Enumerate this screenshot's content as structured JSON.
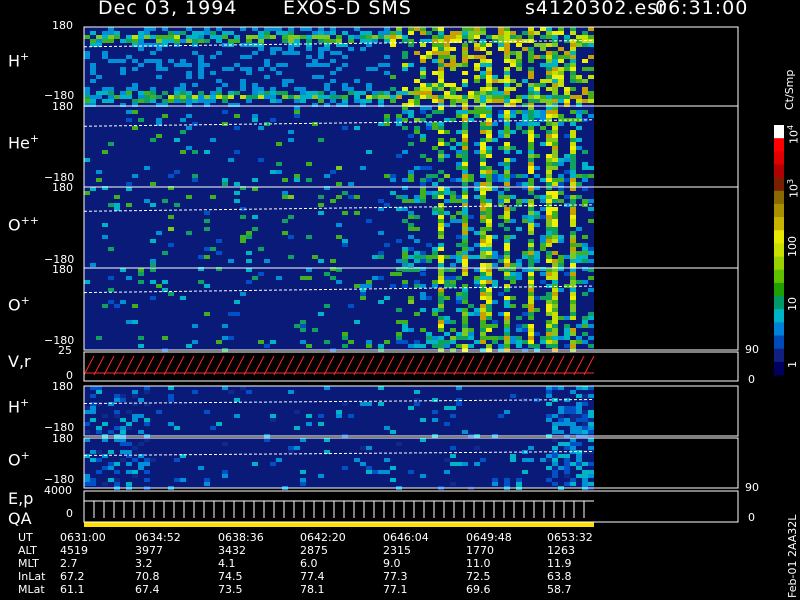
{
  "header": {
    "date": "Dec 03, 1994",
    "instrument": "EXOS-D SMS",
    "file": "s4120302.esr",
    "time": "06:31:00"
  },
  "panels": [
    {
      "label": "H",
      "sup": "+",
      "top": "180",
      "bottom": "−180"
    },
    {
      "label": "He",
      "sup": "+",
      "top": "180",
      "bottom": "−180"
    },
    {
      "label": "O",
      "sup": "++",
      "top": "180",
      "bottom": "−180"
    },
    {
      "label": "O",
      "sup": "+",
      "top": "180",
      "bottom": "−180"
    },
    {
      "label": "V,r",
      "sup": "",
      "top": "25",
      "bottom": "0",
      "right_top": "90",
      "right_bottom": "0"
    },
    {
      "label": "H",
      "sup": "+",
      "top": "180",
      "bottom": "−180"
    },
    {
      "label": "O",
      "sup": "+",
      "top": "180",
      "bottom": "−180"
    },
    {
      "label": "E,p",
      "sup": "",
      "top": "4000",
      "bottom": "0",
      "right_top": "90",
      "right_bottom": "0"
    }
  ],
  "qa_label": "QA",
  "colorbar": {
    "unit": "Ct/Smp",
    "ticks": [
      {
        "base": "10",
        "exp": "4"
      },
      {
        "base": "10",
        "exp": "3"
      },
      {
        "base": "100",
        "exp": ""
      },
      {
        "base": "10",
        "exp": ""
      },
      {
        "base": "1",
        "exp": ""
      }
    ],
    "colors": [
      "#ffffff",
      "#ff0000",
      "#e00000",
      "#b00000",
      "#7a1e00",
      "#8a6a00",
      "#a88f00",
      "#c8b400",
      "#e8e800",
      "#c8e000",
      "#98d000",
      "#5fc000",
      "#20a000",
      "#009a6a",
      "#00b4c8",
      "#0080d8",
      "#004ab8",
      "#102080",
      "#000060"
    ]
  },
  "table": {
    "headers": [
      "UT",
      "ALT",
      "MLT",
      "InLat",
      "MLat"
    ],
    "columns": [
      [
        "0631:00",
        "4519",
        "2.7",
        "67.2",
        "61.1"
      ],
      [
        "0634:52",
        "3977",
        "3.2",
        "70.8",
        "67.4"
      ],
      [
        "0638:36",
        "3432",
        "4.1",
        "74.5",
        "73.5"
      ],
      [
        "0642:20",
        "2875",
        "6.0",
        "77.4",
        "78.1"
      ],
      [
        "0646:04",
        "2315",
        "9.0",
        "77.3",
        "77.1"
      ],
      [
        "0649:48",
        "1770",
        "11.0",
        "72.5",
        "69.6"
      ],
      [
        "0653:32",
        "1263",
        "11.9",
        "63.8",
        "58.7"
      ]
    ]
  },
  "footer": "Feb-01 2AA32L",
  "chart_data": {
    "type": "heatmap",
    "title": "Dec 03, 1994   EXOS-D SMS",
    "xlabel": "UT",
    "x_ticks": [
      "0631:00",
      "0634:52",
      "0638:36",
      "0642:20",
      "0646:04",
      "0649:48",
      "0653:32"
    ],
    "series": [
      {
        "name": "H+",
        "yrange": [
          -180,
          180
        ]
      },
      {
        "name": "He+",
        "yrange": [
          -180,
          180
        ]
      },
      {
        "name": "O++",
        "yrange": [
          -180,
          180
        ]
      },
      {
        "name": "O+",
        "yrange": [
          -180,
          180
        ]
      },
      {
        "name": "V,r",
        "yrange": [
          0,
          25
        ],
        "right_range": [
          0,
          90
        ]
      },
      {
        "name": "H+",
        "yrange": [
          -180,
          180
        ]
      },
      {
        "name": "O+",
        "yrange": [
          -180,
          180
        ]
      },
      {
        "name": "E,p",
        "yrange": [
          0,
          4000
        ],
        "right_range": [
          0,
          90
        ]
      }
    ],
    "colorscale": {
      "label": "Ct/Smp",
      "scale": "log",
      "range": [
        1,
        10000
      ]
    },
    "grid": false
  }
}
